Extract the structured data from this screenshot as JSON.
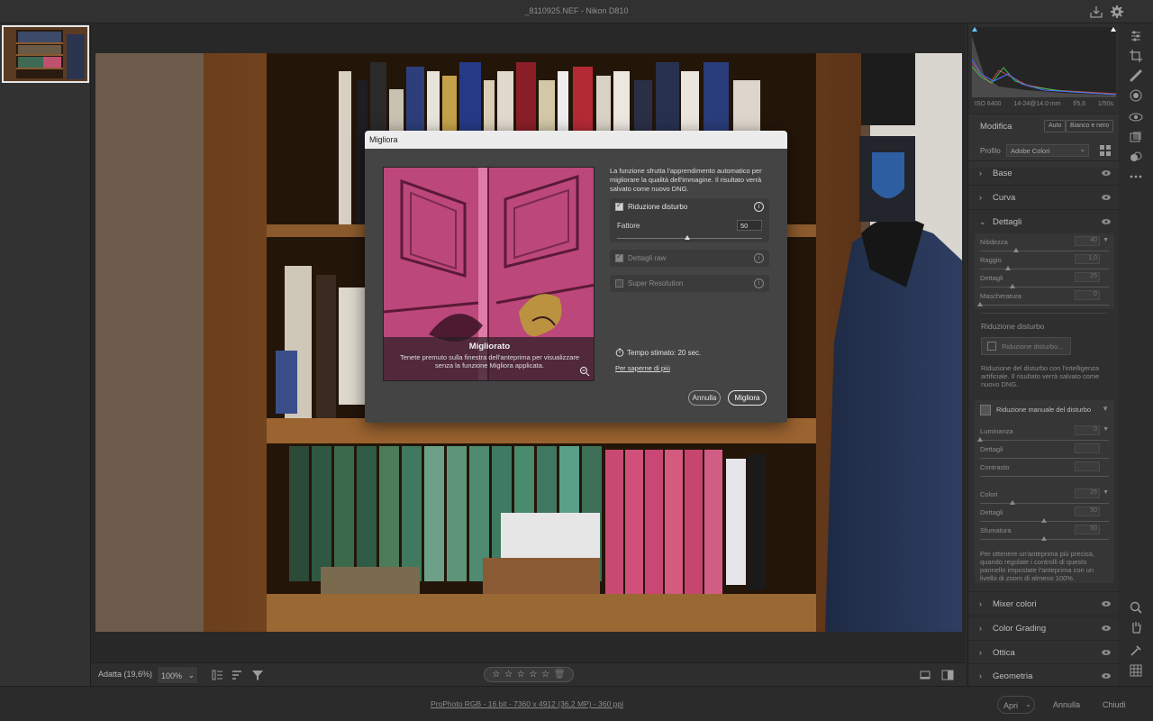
{
  "window": {
    "title": "_8110925.NEF  -  Nikon D810"
  },
  "image_info": {
    "iso": "ISO 6400",
    "lens": "14-24@14.0 mm",
    "aperture": "f/5,6",
    "shutter": "1/50s"
  },
  "edit_panel": {
    "title": "Modifica",
    "auto": "Auto",
    "bw": "Bianco e nero",
    "profile_label": "Profilo",
    "profile_value": "Adobe Colori",
    "sections": {
      "base": "Base",
      "curva": "Curva",
      "dettagli": "Dettagli",
      "mixer": "Mixer colori",
      "grading": "Color Grading",
      "ottica": "Ottica",
      "geometria": "Geometria"
    },
    "dettagli_sliders": [
      {
        "label": "Nitidezza",
        "value": "40"
      },
      {
        "label": "Raggio",
        "value": "1,0"
      },
      {
        "label": "Dettagli",
        "value": "25"
      },
      {
        "label": "Mascheratura",
        "value": "0"
      }
    ],
    "noise": {
      "title": "Riduzione disturbo",
      "ai_button": "Riduzione disturbo...",
      "ai_desc": "Riduzione del disturbo con l'intelligenza artificiale. Il risultato verrà salvato come nuovo DNG.",
      "manual_title": "Riduzione manuale del disturbo",
      "sliders": [
        {
          "label": "Luminanza",
          "value": "0"
        },
        {
          "label": "Dettagli",
          "value": ""
        },
        {
          "label": "Contrasto",
          "value": ""
        },
        {
          "label": "Colori",
          "value": "25"
        },
        {
          "label": "Dettagli",
          "value": "50"
        },
        {
          "label": "Sfumatura",
          "value": "50"
        }
      ],
      "hint": "Per ottenere un'anteprima più precisa, quando regolate i controlli di questo pannello impostate l'anteprima con un livello di zoom di almeno 100%."
    }
  },
  "bottom_bar": {
    "zoom_fit": "Adatta (19,6%)",
    "zoom_level": "100%"
  },
  "status_bar": {
    "info": "ProPhoto RGB - 16 bit - 7360 x 4912 (36,2 MP) - 360 ppi",
    "open": "Apri",
    "cancel": "Annulla",
    "close": "Chiudi"
  },
  "dialog": {
    "title": "Migliora",
    "description": "La funzione sfrutta l'apprendimento automatico per migliorare la qualità dell'immagine. Il risultato verrà salvato come nuovo DNG.",
    "preview_title": "Migliorato",
    "preview_desc": "Tenete premuto sulla finestra dell'anteprima per visualizzare senza la funzione Migliora applicata.",
    "options": {
      "noise_label": "Riduzione disturbo",
      "noise_checked": true,
      "factor_label": "Fattore",
      "factor_value": "50",
      "raw_label": "Dettagli raw",
      "raw_checked": true,
      "sr_label": "Super Resolution",
      "sr_checked": false
    },
    "time": "Tempo stimato: 20 sec.",
    "learn_more": "Per saperne di più",
    "cancel": "Annulla",
    "ok": "Migliora"
  }
}
